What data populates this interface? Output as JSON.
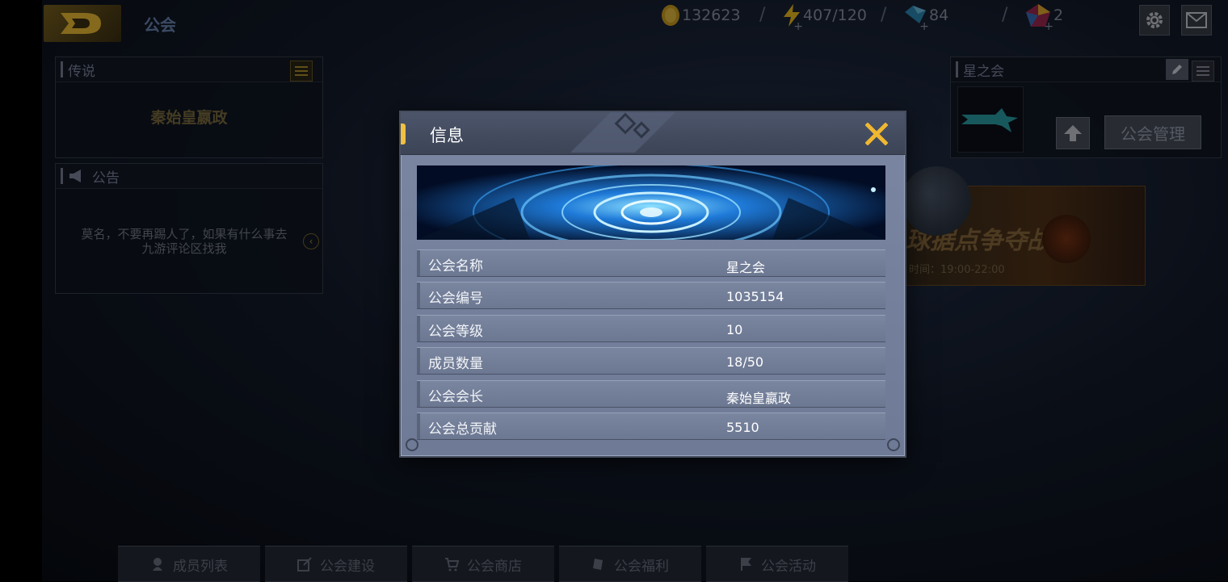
{
  "top_bar": {
    "title": "公会",
    "resources": [
      {
        "name": "gold",
        "value": "132623",
        "color": "#e8b830"
      },
      {
        "name": "energy",
        "value": "407/120",
        "color": "#f0c020"
      },
      {
        "name": "diamond",
        "value": "84",
        "color": "#3aa0d0"
      },
      {
        "name": "crystal",
        "value": "2",
        "color": "#c03060"
      }
    ]
  },
  "legend_panel": {
    "title": "传说",
    "name": "秦始皇嬴政"
  },
  "notice_panel": {
    "title": "公告",
    "text_line1": "莫名，不要再踢人了，如果有什么事去",
    "text_line2": "九游评论区找我"
  },
  "guild_panel": {
    "title": "星之会",
    "manage_button": "公会管理"
  },
  "event_banner": {
    "title": "球据点争夺战",
    "time": "时间：19:00-22:00"
  },
  "bottom_tabs": [
    {
      "label": "成员列表"
    },
    {
      "label": "公会建设"
    },
    {
      "label": "公会商店"
    },
    {
      "label": "公会福利"
    },
    {
      "label": "公会活动"
    }
  ],
  "modal": {
    "title": "信息",
    "rows": [
      {
        "label": "公会名称",
        "value": "星之会"
      },
      {
        "label": "公会编号",
        "value": "1035154"
      },
      {
        "label": "公会等级",
        "value": "10"
      },
      {
        "label": "成员数量",
        "value": "18/50"
      },
      {
        "label": "公会会长",
        "value": "秦始皇嬴政"
      },
      {
        "label": "公会总贡献",
        "value": "5510"
      }
    ]
  },
  "colors": {
    "accent_gold": "#f0c040",
    "modal_bg": "#707c98",
    "close_icon": "#f0b830"
  }
}
